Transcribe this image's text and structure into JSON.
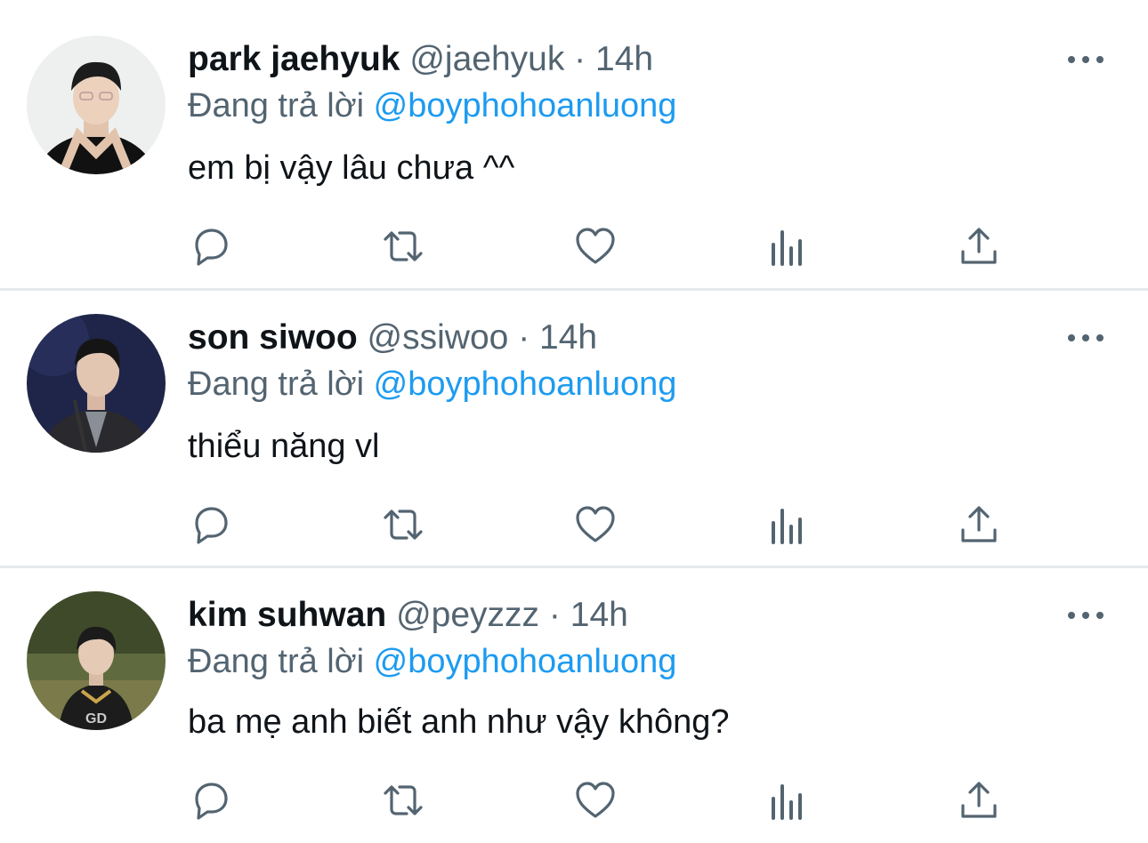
{
  "colors": {
    "text": "#0f1419",
    "secondary": "#536471",
    "link": "#1d9bf0",
    "divider": "#e6e9eb"
  },
  "tweets": [
    {
      "name": "park jaehyuk",
      "handle": "@jaehyuk",
      "separator": "·",
      "time": "14h",
      "reply_prefix": "Đang trả lời",
      "reply_to": "@boyphohoanluong",
      "text": "em bị vậy lâu chưa ^^"
    },
    {
      "name": "son siwoo",
      "handle": "@ssiwoo",
      "separator": "·",
      "time": "14h",
      "reply_prefix": "Đang trả lời",
      "reply_to": "@boyphohoanluong",
      "text": "thiểu năng vl"
    },
    {
      "name": "kim suhwan",
      "handle": "@peyzzz",
      "separator": "·",
      "time": "14h",
      "reply_prefix": "Đang trả lời",
      "reply_to": "@boyphohoanluong",
      "text": "ba mẹ anh biết anh như vậy không?"
    }
  ],
  "icons": [
    "reply-icon",
    "retweet-icon",
    "like-icon",
    "analytics-icon",
    "share-icon",
    "more-options-icon"
  ]
}
